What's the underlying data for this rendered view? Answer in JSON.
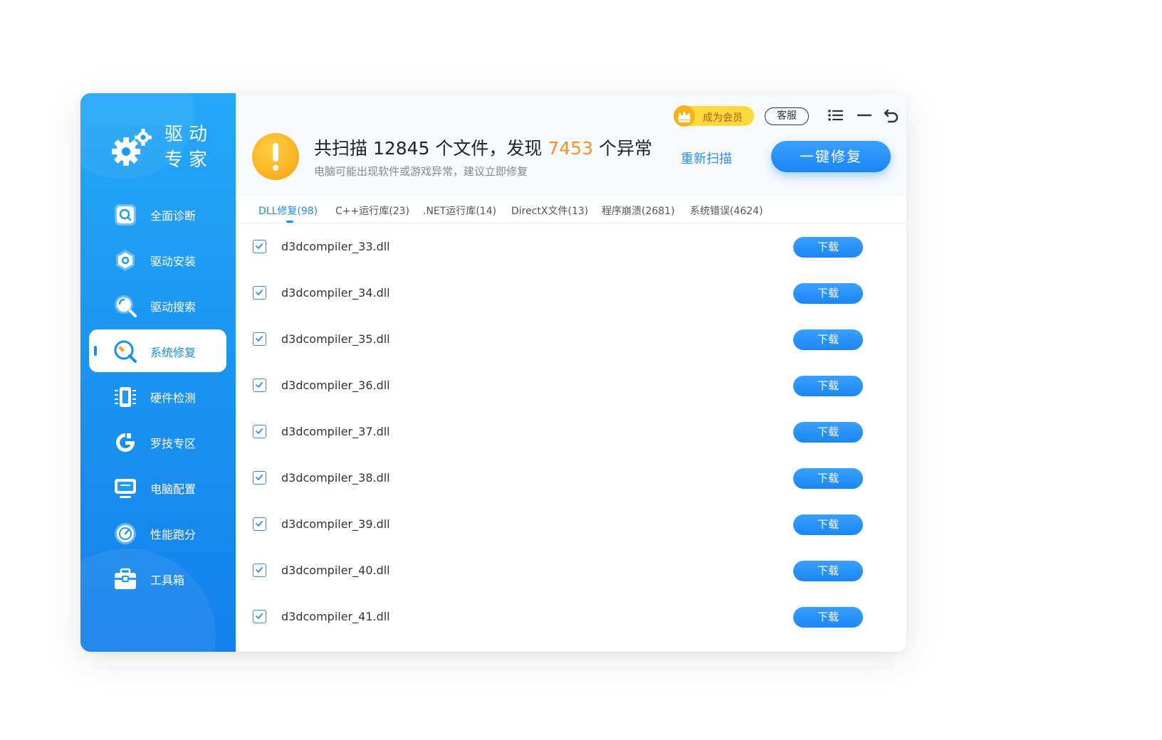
{
  "app": {
    "logo_line1": "驱动",
    "logo_line2": "专家"
  },
  "sidebar": {
    "items": [
      {
        "label": "全面诊断",
        "icon": "scan-icon"
      },
      {
        "label": "驱动安装",
        "icon": "hexagon-icon"
      },
      {
        "label": "驱动搜索",
        "icon": "search-icon"
      },
      {
        "label": "系统修复",
        "icon": "wrench-icon",
        "active": true
      },
      {
        "label": "硬件检测",
        "icon": "chip-icon"
      },
      {
        "label": "罗技专区",
        "icon": "logitech-icon"
      },
      {
        "label": "电脑配置",
        "icon": "monitor-icon"
      },
      {
        "label": "性能跑分",
        "icon": "speedometer-icon"
      },
      {
        "label": "工具箱",
        "icon": "toolbox-icon"
      }
    ]
  },
  "header": {
    "title_prefix": "共扫描 12845 个文件，发现 ",
    "anomaly_count": "7453",
    "title_suffix": " 个异常",
    "subtitle": "电脑可能出现软件或游戏异常，建议立即修复",
    "rescan_label": "重新扫描",
    "fix_label": "一键修复",
    "vip_label": "成为会员",
    "service_label": "客服"
  },
  "tabs": [
    {
      "label": "DLL修复(98)",
      "active": true
    },
    {
      "label": "C++运行库(23)"
    },
    {
      "label": ".NET运行库(14)"
    },
    {
      "label": "DirectX文件(13)"
    },
    {
      "label": "程序崩溃(2681)"
    },
    {
      "label": "系统错误(4624)"
    }
  ],
  "files": [
    {
      "name": "d3dcompiler_33.dll",
      "checked": true,
      "action": "下载"
    },
    {
      "name": "d3dcompiler_34.dll",
      "checked": true,
      "action": "下载"
    },
    {
      "name": "d3dcompiler_35.dll",
      "checked": true,
      "action": "下载"
    },
    {
      "name": "d3dcompiler_36.dll",
      "checked": true,
      "action": "下载"
    },
    {
      "name": "d3dcompiler_37.dll",
      "checked": true,
      "action": "下载"
    },
    {
      "name": "d3dcompiler_38.dll",
      "checked": true,
      "action": "下载"
    },
    {
      "name": "d3dcompiler_39.dll",
      "checked": true,
      "action": "下载"
    },
    {
      "name": "d3dcompiler_40.dll",
      "checked": true,
      "action": "下载"
    },
    {
      "name": "d3dcompiler_41.dll",
      "checked": true,
      "action": "下载"
    }
  ],
  "colors": {
    "accent": "#1a8df0",
    "warning": "#f79120",
    "vip": "#ffd83d"
  }
}
